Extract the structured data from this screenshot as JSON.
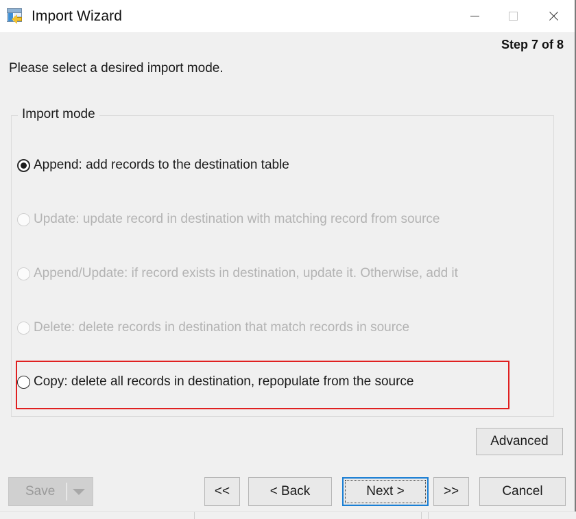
{
  "window": {
    "title": "Import Wizard",
    "icon": "import-table-icon",
    "controls": {
      "minimize": "minimize-icon",
      "maximize": "maximize-icon",
      "close": "close-icon"
    }
  },
  "header": {
    "step_label": "Step 7 of 8",
    "instruction": "Please select a desired import mode."
  },
  "group": {
    "title": "Import mode",
    "options": [
      {
        "label": "Append: add records to the destination table",
        "selected": true,
        "enabled": true,
        "highlighted": false
      },
      {
        "label": "Update: update record in destination with matching record from source",
        "selected": false,
        "enabled": false,
        "highlighted": false
      },
      {
        "label": "Append/Update: if record exists in destination, update it. Otherwise, add it",
        "selected": false,
        "enabled": false,
        "highlighted": false
      },
      {
        "label": "Delete: delete records in destination that match records in source",
        "selected": false,
        "enabled": false,
        "highlighted": false
      },
      {
        "label": "Copy: delete all records in destination, repopulate from the source",
        "selected": false,
        "enabled": true,
        "highlighted": true
      }
    ]
  },
  "advanced_button": {
    "label": "Advanced"
  },
  "footer": {
    "save": {
      "label": "Save",
      "enabled": false,
      "dropdown_icon": "chevron-down-icon"
    },
    "first": {
      "label": "<<"
    },
    "back": {
      "label": "< Back"
    },
    "next": {
      "label": "Next >",
      "focused": true
    },
    "last": {
      "label": ">>"
    },
    "cancel": {
      "label": "Cancel"
    }
  },
  "colors": {
    "accent_focus": "#1a7fd4",
    "highlight_border": "#e02020",
    "window_background": "#f0f0f0",
    "titlebar_background": "#ffffff",
    "disabled_text": "#b3b3b3"
  }
}
